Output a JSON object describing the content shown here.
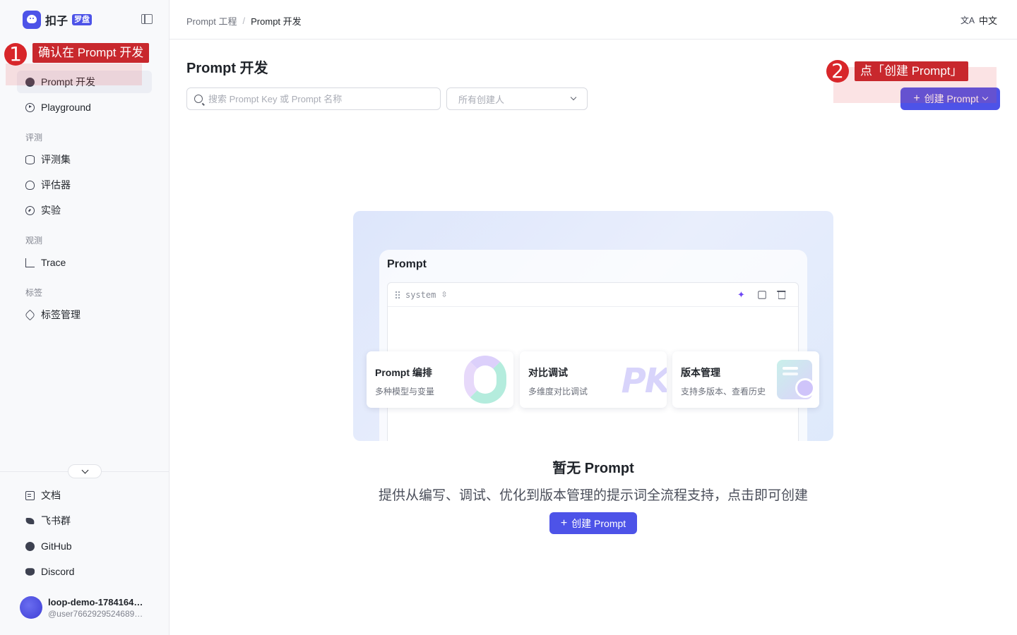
{
  "sidebar": {
    "logo_text": "扣子",
    "logo_badge": "罗盘",
    "items": [
      {
        "label": "Prompt 开发",
        "icon": "prompt-icon",
        "active": true
      },
      {
        "label": "Playground",
        "icon": "play-icon"
      }
    ],
    "sections": [
      {
        "label": "评测",
        "items": [
          {
            "label": "评测集",
            "icon": "database-icon"
          },
          {
            "label": "评估器",
            "icon": "bulb-icon"
          },
          {
            "label": "实验",
            "icon": "gauge-icon"
          }
        ]
      },
      {
        "label": "观测",
        "items": [
          {
            "label": "Trace",
            "icon": "trace-icon"
          }
        ]
      },
      {
        "label": "标签",
        "items": [
          {
            "label": "标签管理",
            "icon": "tag-icon"
          }
        ]
      }
    ],
    "footer_links": [
      {
        "label": "文档",
        "icon": "doc-icon"
      },
      {
        "label": "飞书群",
        "icon": "feishu-icon"
      },
      {
        "label": "GitHub",
        "icon": "github-icon"
      },
      {
        "label": "Discord",
        "icon": "discord-icon"
      }
    ],
    "user": {
      "name": "loop-demo-1784164…",
      "handle": "@user7662929524689…"
    }
  },
  "topbar": {
    "breadcrumb": [
      "Prompt 工程",
      "Prompt 开发"
    ],
    "breadcrumb_sep": "/",
    "language": "中文",
    "language_icon": "文A"
  },
  "main": {
    "title": "Prompt 开发",
    "search_placeholder": "搜索 Prompt Key 或 Prompt 名称",
    "creator_select": "所有创建人",
    "create_button": "创建 Prompt",
    "illustration": {
      "card_title": "Prompt",
      "role_label": "system",
      "features": [
        {
          "title": "Prompt 编排",
          "desc": "多种模型与变量"
        },
        {
          "title": "对比调试",
          "desc": "多维度对比调试",
          "art": "PK"
        },
        {
          "title": "版本管理",
          "desc": "支持多版本、查看历史"
        }
      ]
    },
    "empty_title": "暂无 Prompt",
    "empty_subtitle": "提供从编写、调试、优化到版本管理的提示词全流程支持，点击即可创建",
    "empty_button": "创建 Prompt"
  },
  "annotations": [
    {
      "number": "1",
      "text": "确认在 Prompt 开发"
    },
    {
      "number": "2",
      "text": "点「创建 Prompt」"
    }
  ],
  "colors": {
    "accent": "#4d53e8",
    "annotation_red": "#c8282d"
  }
}
